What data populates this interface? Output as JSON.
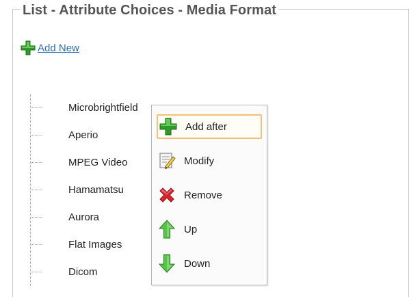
{
  "page": {
    "title": "List - Attribute Choices - Media Format",
    "add_new_label": "Add New"
  },
  "tree": {
    "items": [
      {
        "label": "Microbrightfield"
      },
      {
        "label": "Aperio"
      },
      {
        "label": "MPEG Video"
      },
      {
        "label": "Hamamatsu"
      },
      {
        "label": "Aurora"
      },
      {
        "label": "Flat Images"
      },
      {
        "label": "Dicom"
      }
    ]
  },
  "context_menu": {
    "items": [
      {
        "label": "Add after",
        "icon": "plus-icon",
        "hovered": true
      },
      {
        "label": "Modify",
        "icon": "edit-icon"
      },
      {
        "label": "Remove",
        "icon": "remove-icon"
      },
      {
        "label": "Up",
        "icon": "arrow-up-icon"
      },
      {
        "label": "Down",
        "icon": "arrow-down-icon"
      }
    ]
  },
  "colors": {
    "link": "#2a6fb5",
    "title": "#555555",
    "hover_border": "#f0c178",
    "plus_green": "#3aa82c",
    "remove_red": "#d6262e"
  }
}
